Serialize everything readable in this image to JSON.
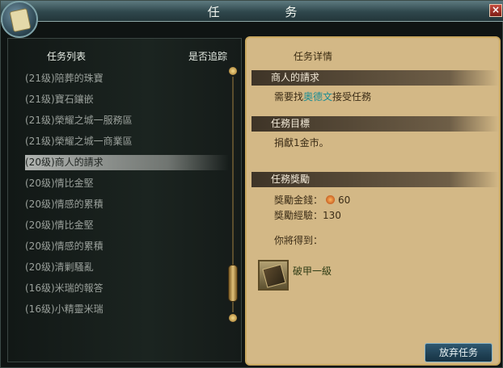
{
  "window": {
    "title": "任 务",
    "close_label": "×"
  },
  "list": {
    "header_left": "任务列表",
    "header_right": "是否追踪",
    "items": [
      {
        "text": "(21级)陪葬的珠寶",
        "selected": false
      },
      {
        "text": "(21级)寶石鑲嵌",
        "selected": false
      },
      {
        "text": "(21级)榮耀之城一服務區",
        "selected": false
      },
      {
        "text": "(21级)榮耀之城一商業區",
        "selected": false
      },
      {
        "text": "(20级)商人的請求",
        "selected": true
      },
      {
        "text": "(20级)情比金堅",
        "selected": false
      },
      {
        "text": "(20级)情感的累積",
        "selected": false
      },
      {
        "text": "(20级)情比金堅",
        "selected": false
      },
      {
        "text": "(20级)情感的累積",
        "selected": false
      },
      {
        "text": "(20级)清剿騷亂",
        "selected": false
      },
      {
        "text": "(16级)米瑞的報答",
        "selected": false
      },
      {
        "text": "(16级)小精靈米瑞",
        "selected": false
      }
    ]
  },
  "detail": {
    "title": "任务详情",
    "quest_name": "商人的請求",
    "desc_prefix": "需要找",
    "desc_npc": "奧德文",
    "desc_suffix": "接受任務",
    "objective_header": "任務目標",
    "objective_text": "捐獻1金市。",
    "reward_header": "任務獎勵",
    "reward_money_label": "獎勵金錢：",
    "reward_money_value": "60",
    "reward_exp_label": "獎勵經驗：",
    "reward_exp_value": "130",
    "you_get": "你將得到：",
    "item_name": "破甲一級"
  },
  "actions": {
    "abandon_label": "放弃任务"
  }
}
